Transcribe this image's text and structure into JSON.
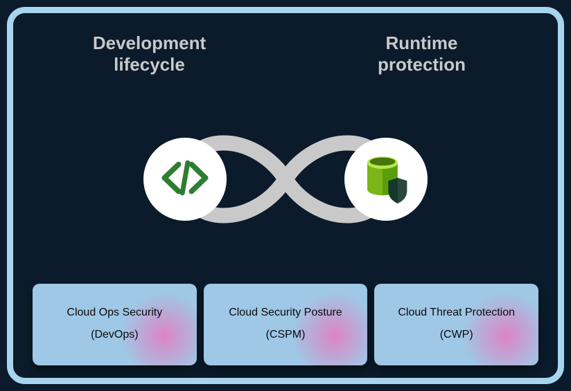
{
  "headings": {
    "left_line1": "Development",
    "left_line2": "lifecycle",
    "right_line1": "Runtime",
    "right_line2": "protection"
  },
  "icons": {
    "left": "code-icon",
    "right": "database-shield-icon"
  },
  "cards": [
    {
      "title": "Cloud Ops Security",
      "sub": "(DevOps)"
    },
    {
      "title": "Cloud Security Posture",
      "sub": "(CSPM)"
    },
    {
      "title": "Cloud Threat Protection",
      "sub": "(CWP)"
    }
  ],
  "colors": {
    "frame_border": "#a7d4ef",
    "background": "#0b1b2b",
    "card_bg": "#9fc8e6",
    "loop": "#c9c9c9",
    "code_green": "#2e7d32",
    "db_green": "#7cb518",
    "shield_dark": "#1a3a2c"
  }
}
